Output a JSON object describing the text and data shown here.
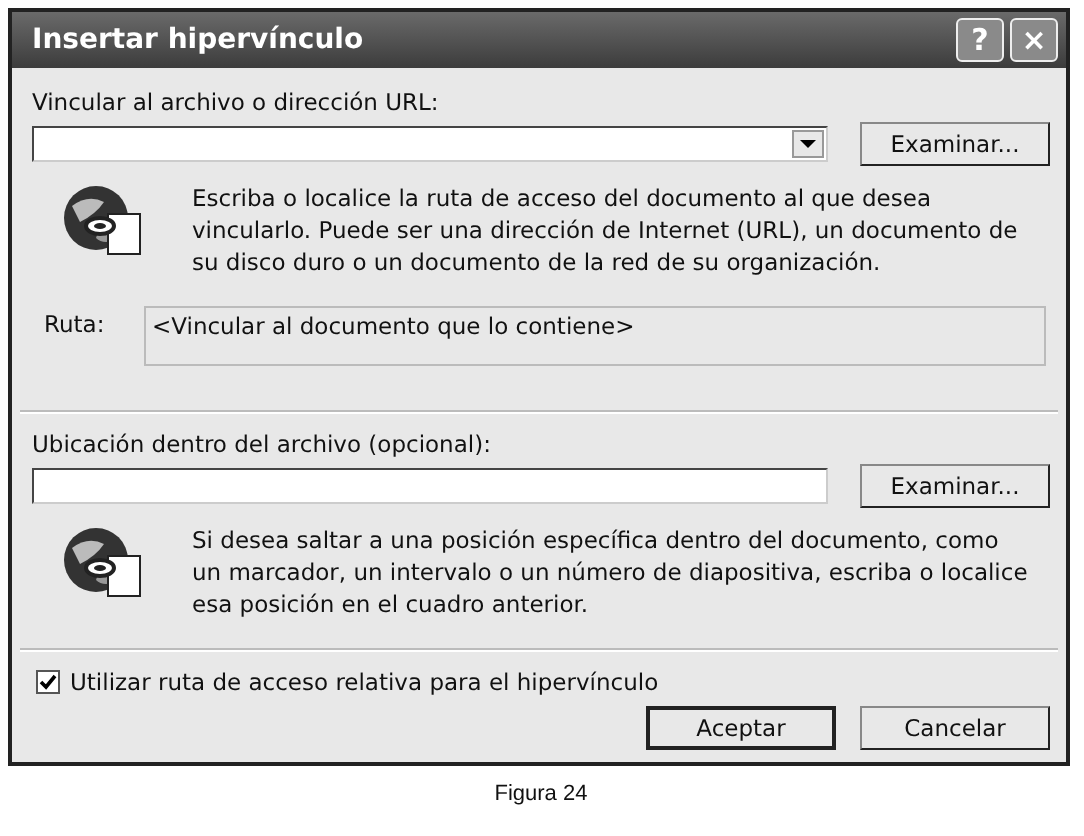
{
  "window": {
    "title": "Insertar hipervínculo",
    "title_buttons": [
      "?",
      "×"
    ]
  },
  "link_section": {
    "label": "Vincular al archivo o dirección URL:",
    "browse_button": "Examinar...",
    "hint": "Escriba o localice la ruta de acceso del documento al que desea vincularlo. Puede ser una dirección de Internet (URL), un documento de su disco duro o un documento de la red de su organización.",
    "path_label": "Ruta:",
    "path_value": "<Vincular al documento que lo contiene>"
  },
  "location_section": {
    "label": "Ubicación dentro del archivo (opcional):",
    "browse_button": "Examinar...",
    "hint": "Si desea saltar a una posición específica dentro del documento, como un marcador, un intervalo o un número de diapositiva, escriba o localice esa posición en el cuadro anterior."
  },
  "relative_path": {
    "label": "Utilizar ruta de acceso relativa para el hipervínculo",
    "checked": true
  },
  "buttons": [
    "Aceptar",
    "Cancelar"
  ],
  "caption": "Figura 24"
}
